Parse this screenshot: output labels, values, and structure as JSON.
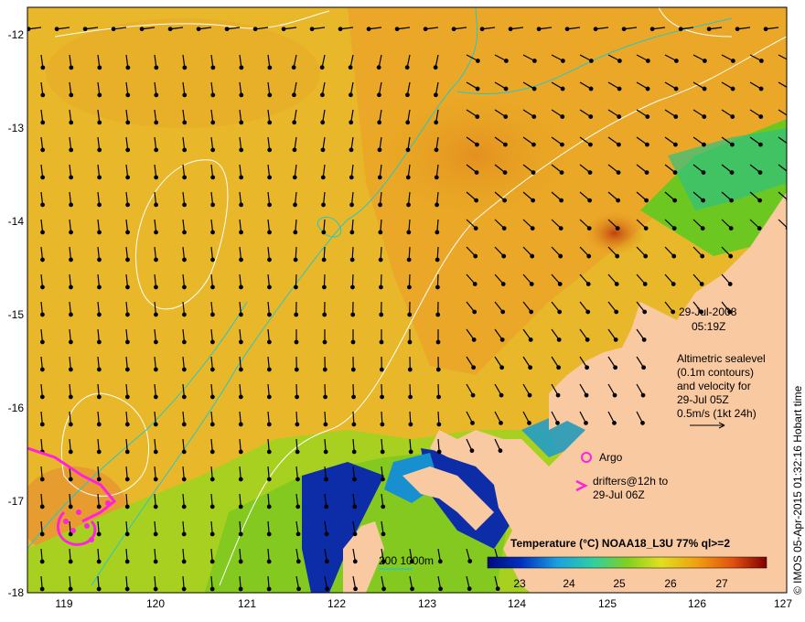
{
  "map": {
    "x_ticks": [
      "119",
      "120",
      "121",
      "122",
      "123",
      "124",
      "125",
      "126",
      "127"
    ],
    "y_ticks": [
      "-12",
      "-13",
      "-14",
      "-15",
      "-16",
      "-17",
      "-18"
    ],
    "colors": {
      "land": "#f9c9a2",
      "warm_sea": "#f0a020",
      "mid_sea": "#e9c020",
      "cool_sea": "#9ed020",
      "cold_sea": "#1028a0",
      "contour": "#ffffff",
      "bathymetry": "#27c6c6",
      "drifter": "#ff22dd"
    }
  },
  "annotation": {
    "date": "29-Jul-2008",
    "time": "05:19Z",
    "line1": "Altimetric sealevel",
    "line2": "(0.1m contours)",
    "line3": "and velocity for",
    "line4": "29-Jul 05Z",
    "line5": "0.5m/s (1kt 24h)"
  },
  "legend": {
    "argo": "Argo",
    "drifters_line1": "drifters@12h to",
    "drifters_line2": "29-Jul 06Z",
    "bathy_label": "200  1000m"
  },
  "colorbar": {
    "title": "Temperature (°C) NOAA18_L3U 77% ql>=2",
    "ticks": [
      "23",
      "24",
      "25",
      "26",
      "27"
    ],
    "min": 22.5,
    "max": 27.8
  },
  "credit": "© IMOS 05-Apr-2015 01:32:16 Hobart time"
}
